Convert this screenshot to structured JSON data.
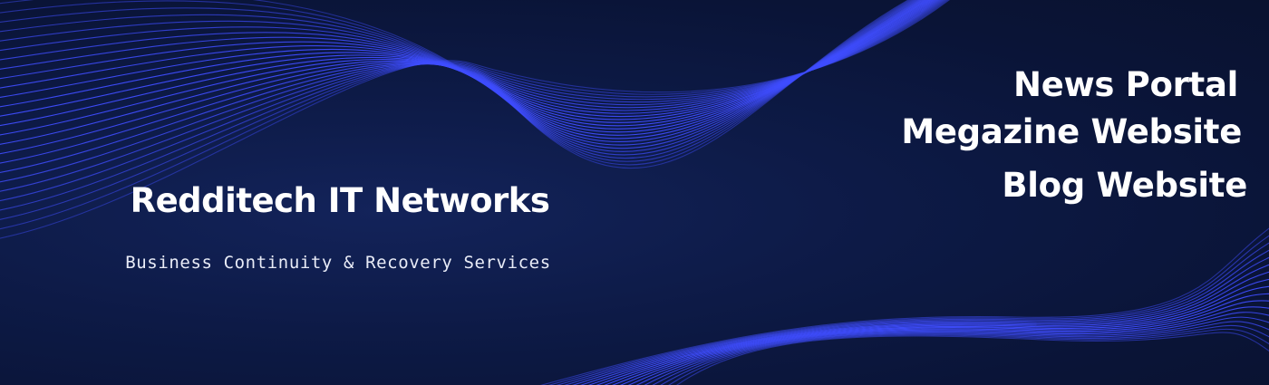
{
  "brand": {
    "name": "Redditech IT Networks",
    "tagline": "Business Continuity & Recovery Services"
  },
  "offerings": {
    "line1": "News Portal",
    "line2": "Megazine Website",
    "line3": "Blog Website"
  },
  "colors": {
    "background": "#0b1538",
    "wave_stroke": "#3f4dff",
    "text": "#ffffff"
  }
}
